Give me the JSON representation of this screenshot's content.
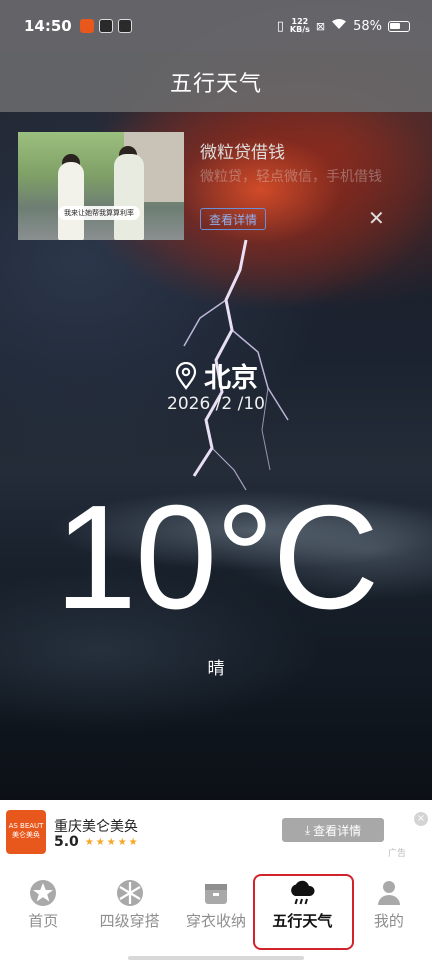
{
  "status_bar": {
    "time": "14:50",
    "network_speed_value": "122",
    "network_speed_unit": "KB/s",
    "battery": "58%"
  },
  "header": {
    "title": "五行天气"
  },
  "top_ad": {
    "title": "微粒贷借钱",
    "subtitle": "微粒贷，轻点微信，手机借钱",
    "thumb_caption": "我来让她帮我算算利率",
    "button_label": "查看详情",
    "close_symbol": "✕"
  },
  "weather": {
    "city": "北京",
    "date": "2026 /2 /10",
    "temperature": "10°C",
    "condition": "晴"
  },
  "bottom_ad": {
    "logo_text": "AS BEAUT\n美仑美奂",
    "name": "重庆美仑美奂",
    "rating": "5.0",
    "stars": "★★★★★",
    "button_label": "查看详情",
    "ad_tag": "广告",
    "close_symbol": "×"
  },
  "tabs": [
    {
      "label": "首页",
      "icon": "star-badge-icon"
    },
    {
      "label": "四级穿搭",
      "icon": "snowflake-sun-icon"
    },
    {
      "label": "穿衣收纳",
      "icon": "wardrobe-box-icon"
    },
    {
      "label": "五行天气",
      "icon": "rain-cloud-icon",
      "active": true
    },
    {
      "label": "我的",
      "icon": "person-icon"
    }
  ],
  "colors": {
    "active_tab_outline": "#d2232a",
    "inactive_tab": "#8e8e8e",
    "ad_button_border": "#6a8fd8",
    "star": "#f5a623"
  }
}
